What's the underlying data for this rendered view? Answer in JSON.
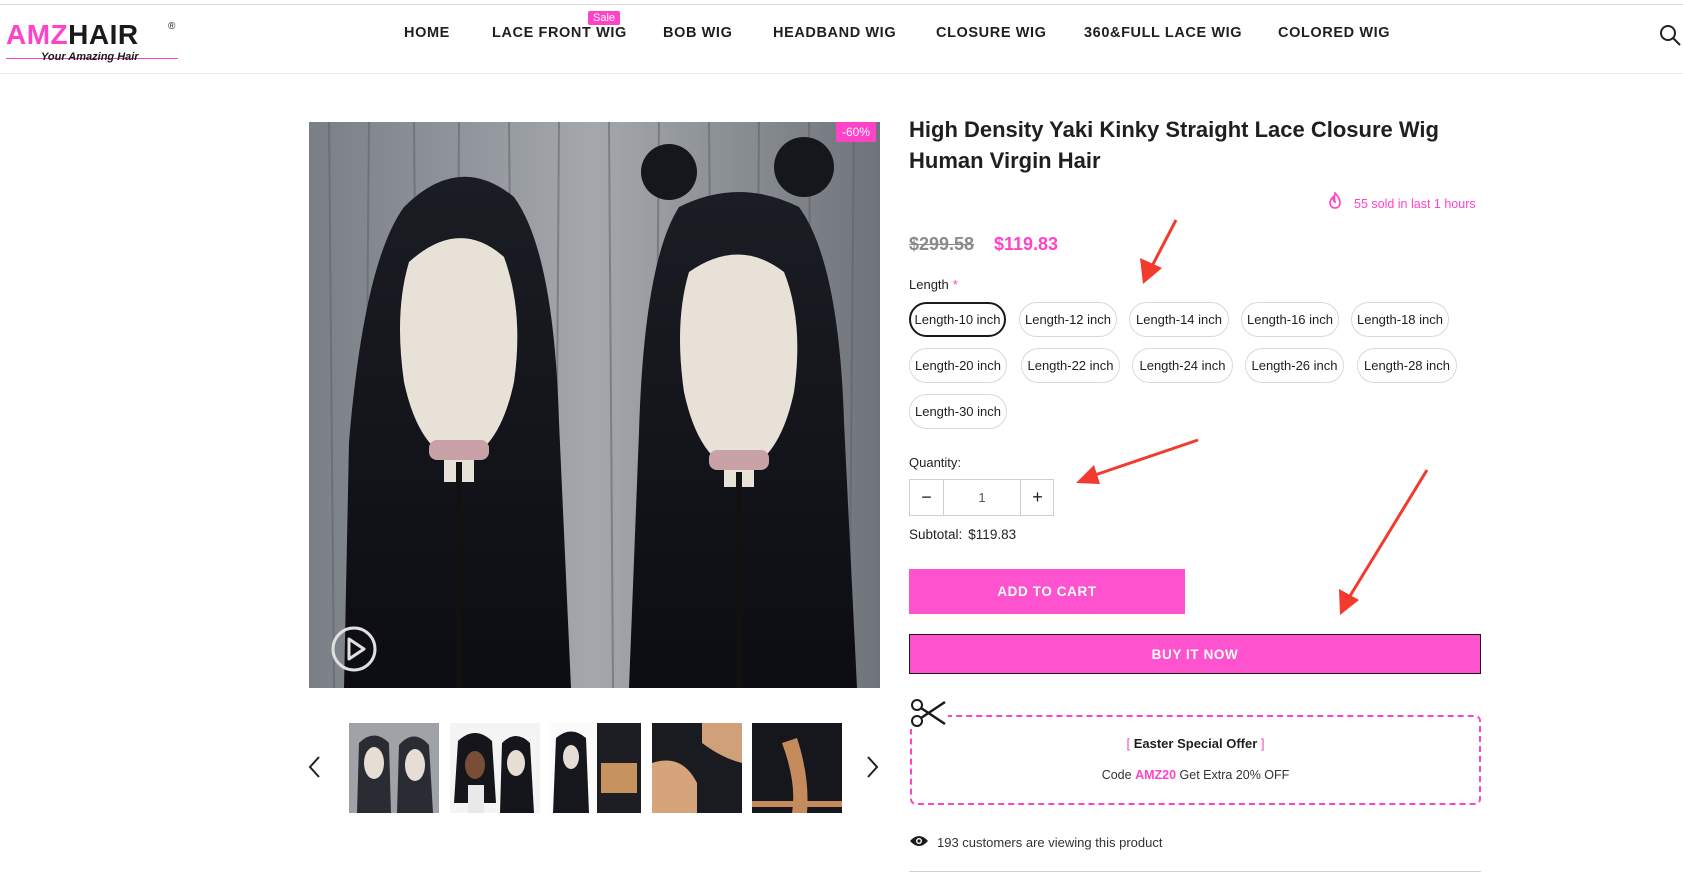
{
  "brand": {
    "logo_amz": "AMZ",
    "logo_hair": "HAIR",
    "logo_reg": "®",
    "tagline": "Your Amazing Hair"
  },
  "nav": {
    "items": [
      "HOME",
      "LACE FRONT WIG",
      "BOB WIG",
      "HEADBAND WIG",
      "CLOSURE WIG",
      "360&FULL LACE WIG",
      "COLORED WIG"
    ],
    "sale_badge": "Sale"
  },
  "product": {
    "discount": "-60%",
    "title": "High Density Yaki Kinky Straight Lace Closure Wig Human Virgin Hair",
    "sold_text": "55 sold in last 1 hours",
    "old_price": "$299.58",
    "new_price": "$119.83",
    "length_label": "Length",
    "required_mark": "*",
    "lengths": [
      "Length-10 inch",
      "Length-12 inch",
      "Length-14 inch",
      "Length-16 inch",
      "Length-18 inch",
      "Length-20 inch",
      "Length-22 inch",
      "Length-24 inch",
      "Length-26 inch",
      "Length-28 inch",
      "Length-30 inch"
    ],
    "selected_length": "Length-10 inch",
    "quantity_label": "Quantity:",
    "quantity": "1",
    "qty_minus": "−",
    "qty_plus": "+",
    "subtotal_label": "Subtotal:",
    "subtotal_value": "$119.83",
    "add_to_cart": "ADD TO CART",
    "buy_it_now": "BUY IT NOW"
  },
  "offer": {
    "bracket_open": "[",
    "title": "Easter Special Offer",
    "bracket_close": "]",
    "code_prefix": "Code",
    "code": "AMZ20",
    "code_suffix": "Get Extra 20% OFF"
  },
  "viewers_text": "193 customers are viewing this product",
  "colors": {
    "accent": "#ff43c8",
    "button": "#ff52cf",
    "annotation_arrow": "#f23a2e"
  },
  "icons": {
    "search": "search-icon",
    "play": "play-icon",
    "fire": "fire-icon",
    "scissors": "scissors-icon",
    "eye": "eye-icon",
    "prev": "chevron-left-icon",
    "next": "chevron-right-icon"
  }
}
